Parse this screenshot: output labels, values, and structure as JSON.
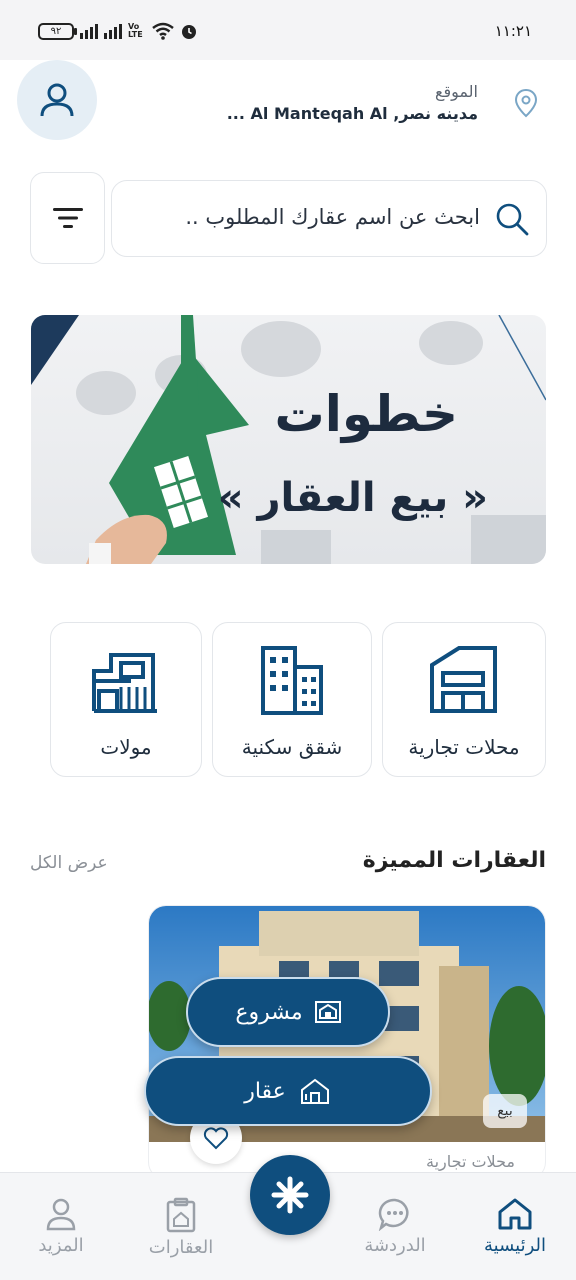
{
  "status_bar": {
    "time": "١١:٢١",
    "battery": "٩٢",
    "network": "Vo LTE"
  },
  "header": {
    "location_label": "الموقع",
    "location_value": "مدينه نصر, Al Manteqah Al ..."
  },
  "search": {
    "placeholder": "ابحث عن اسم عقارك المطلوب .."
  },
  "banner": {
    "title": "خطوات",
    "subtitle": "« بيع العقار »"
  },
  "categories": [
    {
      "label": "محلات تجارية",
      "icon": "shop-icon"
    },
    {
      "label": "شقق سكنية",
      "icon": "apartment-building-icon"
    },
    {
      "label": "مولات",
      "icon": "mall-icon"
    }
  ],
  "featured": {
    "title": "العقارات المميزة",
    "see_all": "عرض الكل",
    "card": {
      "badge": "بيع",
      "type": "محلات تجارية"
    }
  },
  "fab_menu": {
    "project_label": "مشروع",
    "property_label": "عقار"
  },
  "bottom_nav": {
    "items": [
      {
        "label": "الرئيسية",
        "icon": "home-icon",
        "active": true
      },
      {
        "label": "الدردشة",
        "icon": "chat-icon",
        "active": false
      },
      {
        "label": "العقارات",
        "icon": "properties-icon",
        "active": false
      },
      {
        "label": "المزيد",
        "icon": "user-icon",
        "active": false
      }
    ]
  },
  "colors": {
    "primary": "#0f4e7e",
    "banner_green": "#2f8a5a",
    "muted": "#9aa0a8"
  }
}
